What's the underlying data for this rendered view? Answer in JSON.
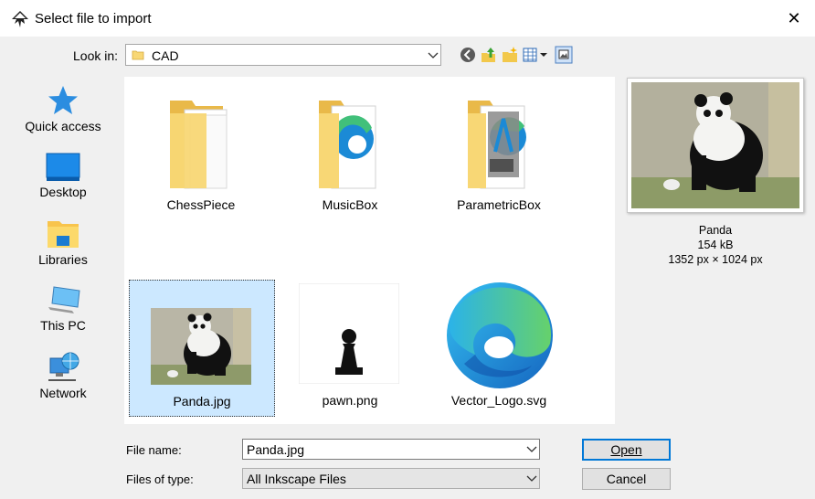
{
  "window": {
    "title": "Select file to import",
    "close_glyph": "✕"
  },
  "toolbar": {
    "lookin_label": "Look in:",
    "lookin_value": "CAD"
  },
  "places": [
    {
      "label": "Quick access",
      "icon": "star-icon"
    },
    {
      "label": "Desktop",
      "icon": "desktop-icon"
    },
    {
      "label": "Libraries",
      "icon": "libraries-icon"
    },
    {
      "label": "This PC",
      "icon": "computer-icon"
    },
    {
      "label": "Network",
      "icon": "network-icon"
    }
  ],
  "files": [
    {
      "name": "ChessPiece",
      "type": "folder"
    },
    {
      "name": "MusicBox",
      "type": "folder"
    },
    {
      "name": "ParametricBox",
      "type": "folder"
    },
    {
      "name": "Panda.jpg",
      "type": "image",
      "selected": true
    },
    {
      "name": "pawn.png",
      "type": "image"
    },
    {
      "name": "Vector_Logo.svg",
      "type": "svg"
    }
  ],
  "preview": {
    "name": "Panda",
    "size": "154 kB",
    "dimensions": "1352 px × 1024 px"
  },
  "form": {
    "filename_label": "File name:",
    "filename_value": "Panda.jpg",
    "filetype_label": "Files of type:",
    "filetype_value": "All Inkscape Files",
    "open_label": "Open",
    "cancel_label": "Cancel"
  },
  "colors": {
    "selection": "#cce8ff",
    "accent": "#0078d7",
    "folder": "#f8d775"
  }
}
